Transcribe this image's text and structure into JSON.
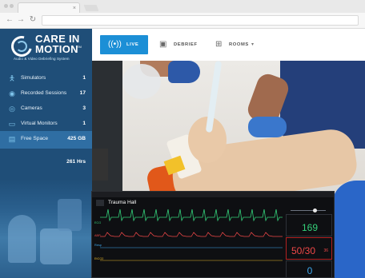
{
  "sidebar": {
    "logo": {
      "line1": "CARE IN",
      "line2": "MOTION",
      "trademark": "TM",
      "tagline": "Audio & Video Debriefing System"
    },
    "items": [
      {
        "label": "Simulators",
        "count": "1",
        "icon": "person-icon"
      },
      {
        "label": "Recorded Sessions",
        "count": "17",
        "icon": "play-circle-icon"
      },
      {
        "label": "Cameras",
        "count": "3",
        "icon": "camera-icon"
      },
      {
        "label": "Virtual Monitors",
        "count": "1",
        "icon": "monitor-icon"
      },
      {
        "label": "Free Space",
        "count": "425 GB",
        "icon": "drive-icon"
      }
    ],
    "hours": "261 Hrs"
  },
  "topnav": {
    "live": "LIVE",
    "debrief": "DEBRIEF",
    "rooms": "ROOMS"
  },
  "monitor": {
    "case_title": "Trauma Hall",
    "hr_value": "169",
    "bp_value": "50/30",
    "bp_sub": "36",
    "spo2_value": "0",
    "labels": {
      "ecg": "ECG",
      "abp": "ABP",
      "resp": "Resp",
      "etco2": "EtCO2"
    }
  },
  "colors": {
    "sidebar": "#1f4e78",
    "accent": "#1c8fd6",
    "hr": "#34d07a",
    "bp": "#f04848",
    "spo2": "#3ea8ee"
  }
}
